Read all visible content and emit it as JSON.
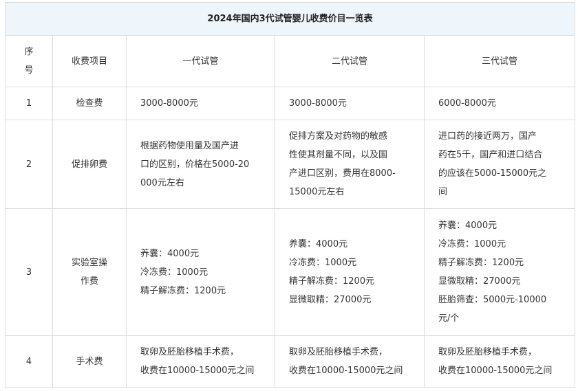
{
  "table": {
    "title": "2024年国内3代试管婴儿收费价目一览表",
    "headers": {
      "num_line1": "序",
      "num_line2": "号",
      "item": "收费项目",
      "gen1": "一代试管",
      "gen2": "二代试管",
      "gen3": "三代试管"
    },
    "rows": [
      {
        "num": "1",
        "item": "检查费",
        "gen1": [
          "3000-8000元"
        ],
        "gen2": [
          "3000-8000元"
        ],
        "gen3": [
          "6000-8000元"
        ]
      },
      {
        "num": "2",
        "item": "促排卵费",
        "gen1": [
          "根据药物使用量及国产进",
          "口的区别，价格在5000-20",
          "000元左右"
        ],
        "gen2": [
          "促排方案及对药物的敏感",
          "性使其剂量不同，以及国",
          "产进口区别，费用在8000-",
          "15000元左右"
        ],
        "gen3": [
          "进口药的接近两万，国产",
          "药在5千，国产和进口结合",
          "的应该在5000-15000元之",
          "间"
        ]
      },
      {
        "num": "3",
        "item_line1": "实验室操",
        "item_line2": "作费",
        "gen1": [
          "养囊：4000元",
          "冷冻费：1000元",
          "精子解冻费：1200元"
        ],
        "gen2": [
          "养囊：4000元",
          "冷冻费：1000元",
          "精子解冻费：1200元",
          "显微取精：27000元"
        ],
        "gen3": [
          "养囊：4000元",
          "冷冻费：1000元",
          "精子解冻费：1200元",
          "显微取精：27000元",
          "胚胎筛查：5000元-10000",
          "元/个"
        ]
      },
      {
        "num": "4",
        "item": "手术费",
        "gen1": [
          "取卵及胚胎移植手术费，",
          "收费在10000-15000元之间"
        ],
        "gen2": [
          "取卵及胚胎移植手术费，",
          "收费在10000-15000元之间"
        ],
        "gen3": [
          "取卵及胚胎移植手术费，",
          "收费在10000-15000元之间"
        ]
      }
    ]
  }
}
